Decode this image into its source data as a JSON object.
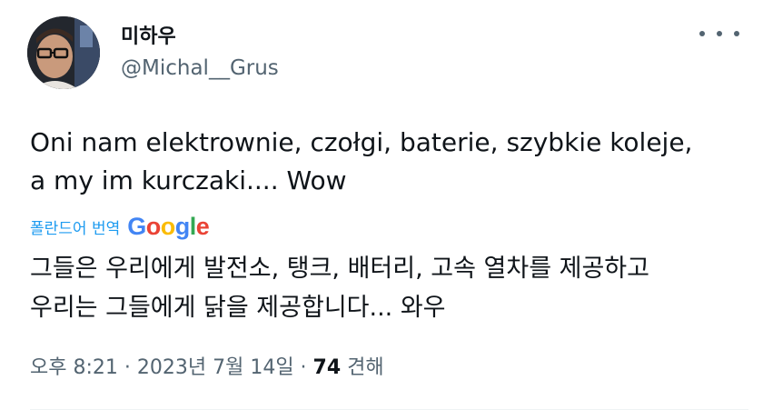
{
  "author": {
    "display_name": "미하우",
    "handle": "@Michal__Grus"
  },
  "icons": {
    "more": "more-horizontal-icon"
  },
  "tweet": {
    "text_line1": "Oni nam elektrownie, czołgi, baterie, szybkie koleje,",
    "text_line2": "a my im kurczaki.... Wow"
  },
  "translation": {
    "label": "폴란드어 번역",
    "provider_letters": [
      "G",
      "o",
      "o",
      "g",
      "l",
      "e"
    ],
    "provider_colors": [
      "#4285f4",
      "#ea4335",
      "#fbbc05",
      "#4285f4",
      "#34a853",
      "#ea4335"
    ],
    "text_line1": "그들은 우리에게 발전소, 탱크, 배터리, 고속 열차를 제공하고",
    "text_line2": "우리는 그들에게 닭을 제공합니다... 와우"
  },
  "meta": {
    "time": "오후 8:21",
    "sep1": " · ",
    "date": "2023년 7월 14일",
    "sep2": " · ",
    "views_count": "74",
    "views_label": " 견해"
  }
}
